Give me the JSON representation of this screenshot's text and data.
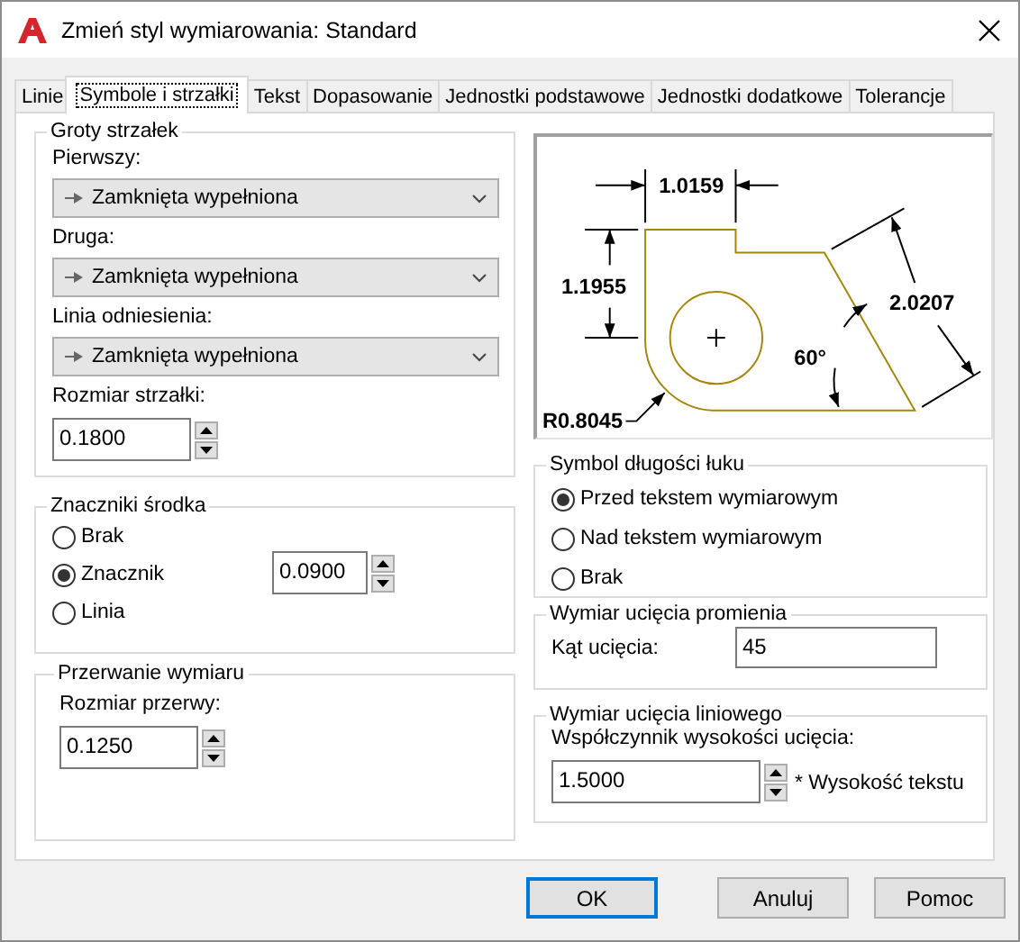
{
  "window": {
    "title": "Zmień styl wymiarowania: Standard"
  },
  "tabs": [
    {
      "label": "Linie",
      "selected": false
    },
    {
      "label": "Symbole i strzałki",
      "selected": true
    },
    {
      "label": "Tekst",
      "selected": false
    },
    {
      "label": "Dopasowanie",
      "selected": false
    },
    {
      "label": "Jednostki podstawowe",
      "selected": false
    },
    {
      "label": "Jednostki dodatkowe",
      "selected": false
    },
    {
      "label": "Tolerancje",
      "selected": false
    }
  ],
  "arrowheads": {
    "title": "Groty strzałek",
    "fields": [
      {
        "label": "Pierwszy:",
        "value": "Zamknięta wypełniona"
      },
      {
        "label": "Druga:",
        "value": "Zamknięta wypełniona"
      },
      {
        "label": "Linia odniesienia:",
        "value": "Zamknięta wypełniona"
      }
    ],
    "size": {
      "label": "Rozmiar strzałki:",
      "value": "0.1800"
    }
  },
  "center_marks": {
    "title": "Znaczniki środka",
    "options": [
      {
        "label": "Brak",
        "selected": false
      },
      {
        "label": "Znacznik",
        "selected": true
      },
      {
        "label": "Linia",
        "selected": false
      }
    ],
    "size": {
      "value": "0.0900"
    }
  },
  "dimension_break": {
    "title": "Przerwanie wymiaru",
    "size": {
      "label": "Rozmiar przerwy:",
      "value": "0.1250"
    }
  },
  "preview": {
    "labels": [
      "1.0159",
      "1.1955",
      "2.0207",
      "60°",
      "R0.8045"
    ]
  },
  "arc_length_symbol": {
    "title": "Symbol długości łuku",
    "options": [
      {
        "label": "Przed tekstem wymiarowym",
        "selected": true
      },
      {
        "label": "Nad tekstem wymiarowym",
        "selected": false
      },
      {
        "label": "Brak",
        "selected": false
      }
    ]
  },
  "radius_jog": {
    "title": "Wymiar ucięcia promienia",
    "angle": {
      "label": "Kąt ucięcia:",
      "value": "45"
    }
  },
  "linear_jog": {
    "title": "Wymiar ucięcia liniowego",
    "factor": {
      "label": "Współczynnik wysokości ucięcia:",
      "value": "1.5000",
      "suffix": "* Wysokość tekstu"
    }
  },
  "buttons": [
    {
      "label": "OK",
      "default": true
    },
    {
      "label": "Anuluj",
      "default": false
    },
    {
      "label": "Pomoc",
      "default": false
    }
  ]
}
